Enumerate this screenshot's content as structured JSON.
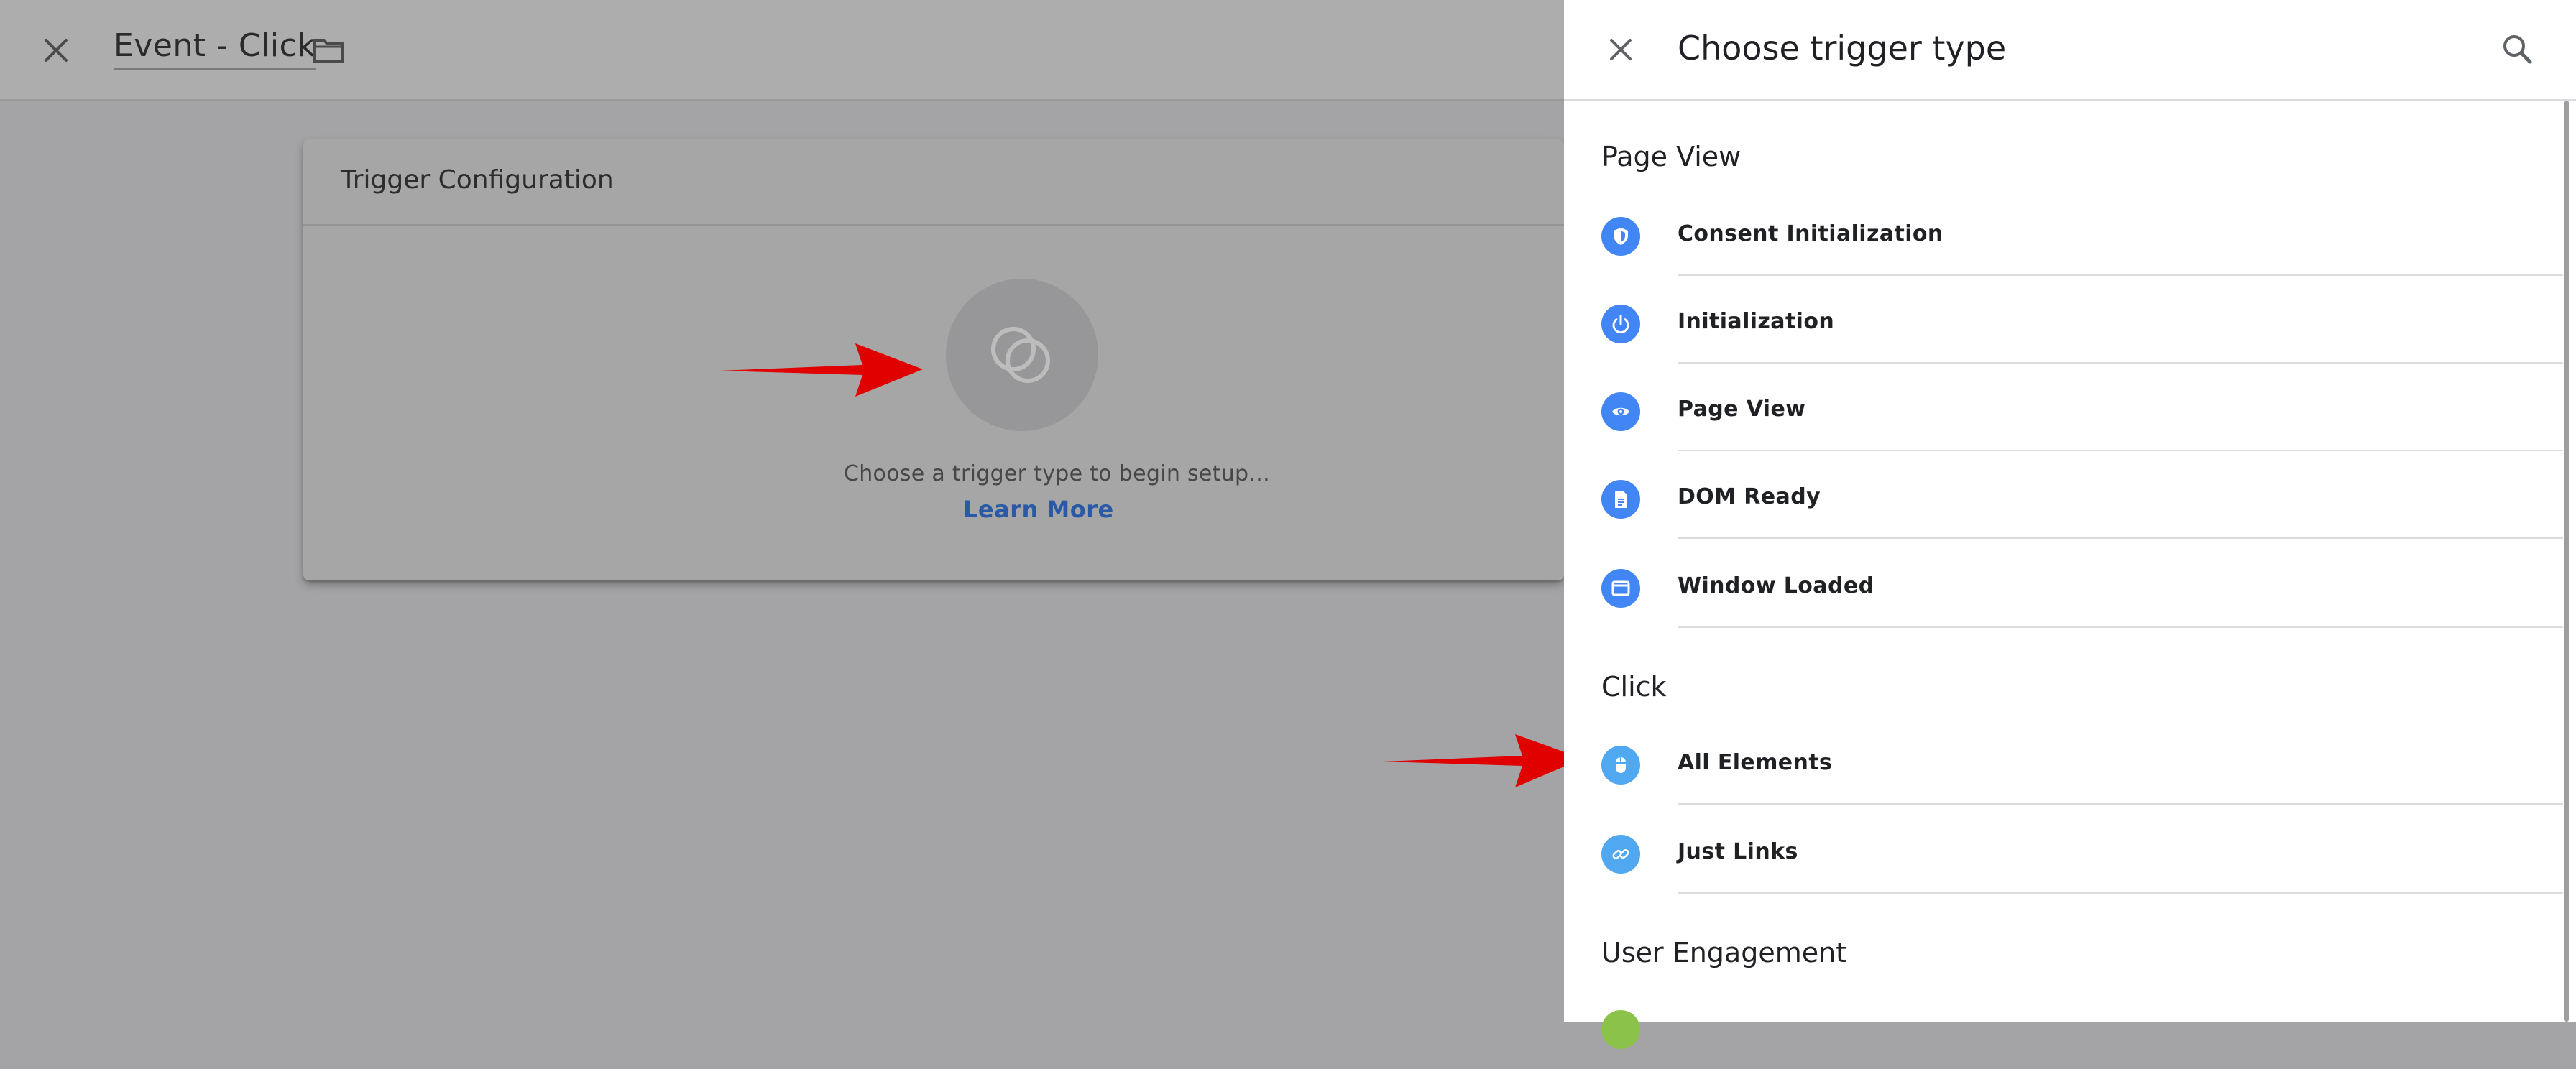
{
  "editor": {
    "title": "Event - Click",
    "card_title": "Trigger Configuration",
    "hint": "Choose a trigger type to begin setup...",
    "learn_more": "Learn More"
  },
  "panel": {
    "title": "Choose trigger type",
    "sections": [
      {
        "title": "Page View",
        "items": [
          {
            "label": "Consent Initialization",
            "icon": "shield-icon",
            "color": "#4285f4"
          },
          {
            "label": "Initialization",
            "icon": "power-icon",
            "color": "#4285f4"
          },
          {
            "label": "Page View",
            "icon": "eye-icon",
            "color": "#4285f4"
          },
          {
            "label": "DOM Ready",
            "icon": "document-icon",
            "color": "#4285f4"
          },
          {
            "label": "Window Loaded",
            "icon": "window-icon",
            "color": "#4285f4"
          }
        ]
      },
      {
        "title": "Click",
        "items": [
          {
            "label": "All Elements",
            "icon": "mouse-icon",
            "color": "#4fa8f0"
          },
          {
            "label": "Just Links",
            "icon": "link-icon",
            "color": "#4fa8f0"
          }
        ]
      },
      {
        "title": "User Engagement",
        "items": [
          {
            "label": "",
            "icon": "visibility-icon",
            "color": "#8bc34a"
          }
        ]
      }
    ]
  },
  "colors": {
    "accent_blue": "#4285f4",
    "click_blue": "#4fa8f0",
    "link_blue": "#2a5aa6",
    "arrow_red": "#e00000"
  }
}
